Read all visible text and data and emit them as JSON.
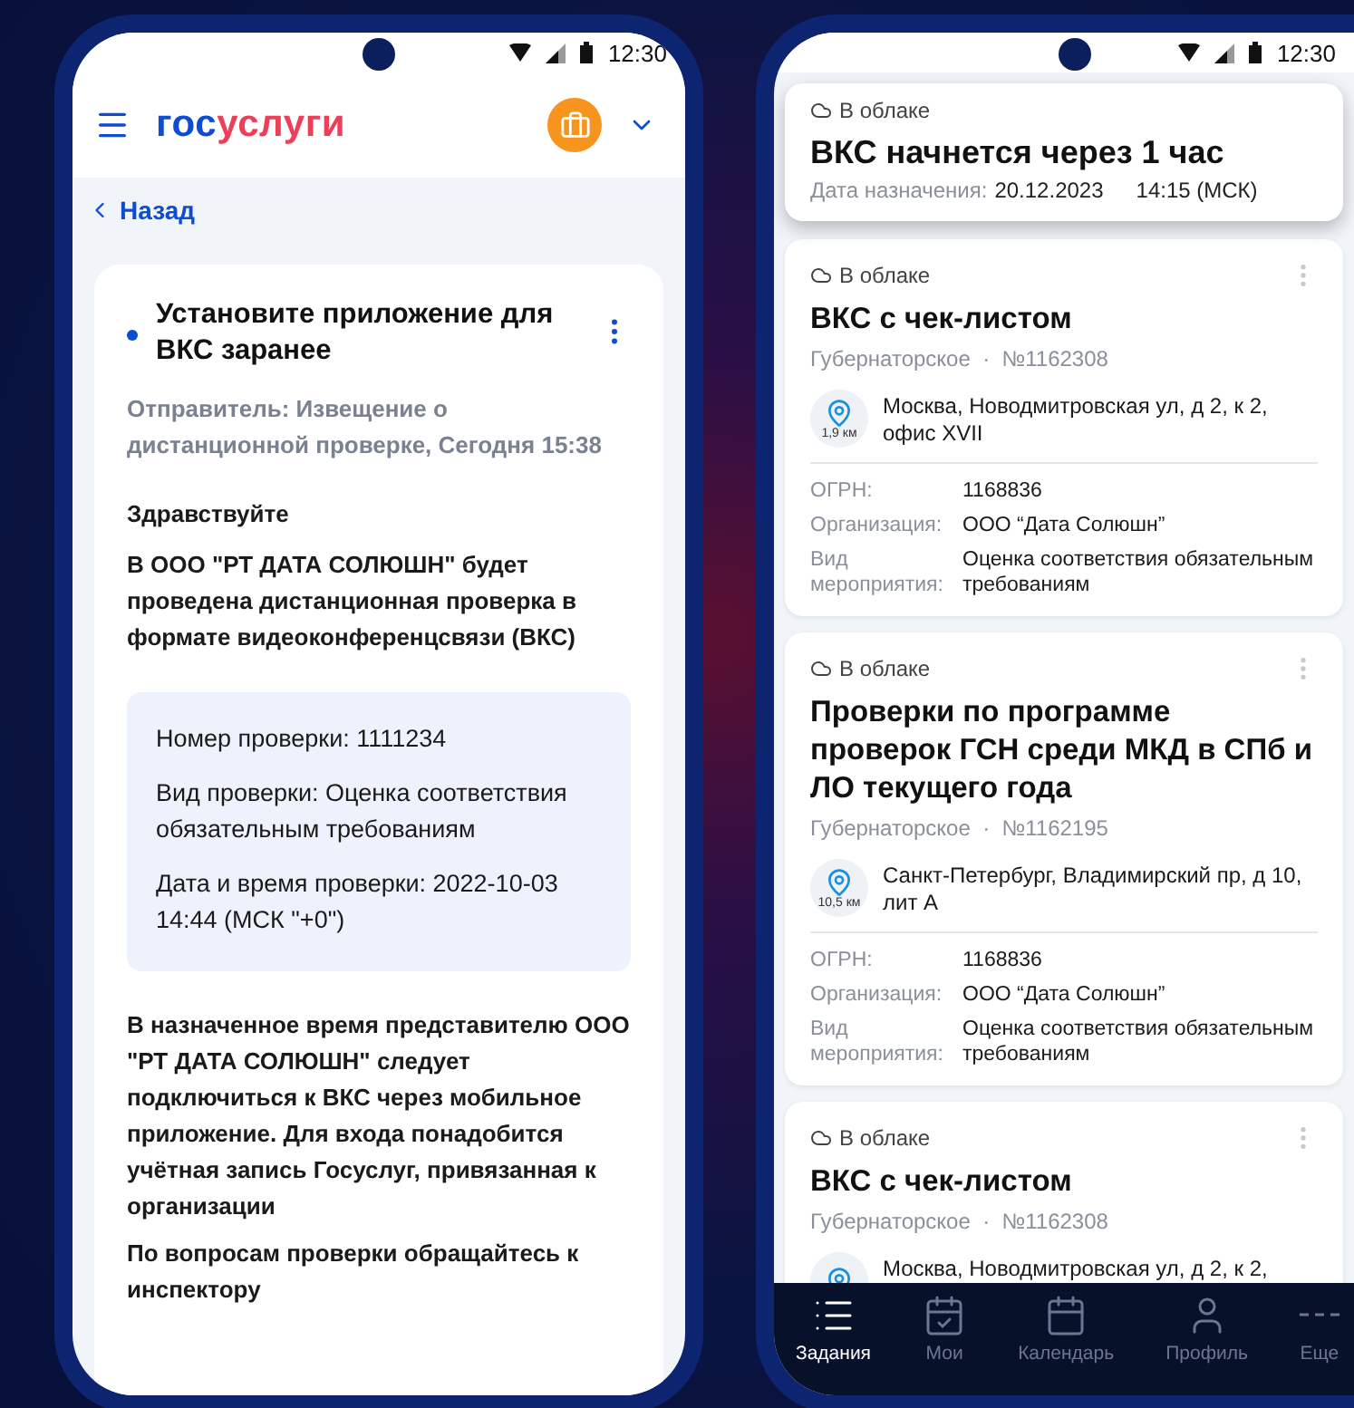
{
  "left_phone": {
    "status_bar": {
      "time": "12:30"
    },
    "header": {
      "logo": [
        {
          "text": "гос",
          "color": "#0d4cd3"
        },
        {
          "text": "услуги",
          "color": "#ee3f58"
        }
      ]
    },
    "back_link": "Назад",
    "message": {
      "unread": true,
      "title": "Установите приложение для ВКС заранее",
      "sender": "Отправитель: Извещение о дистанционной проверке, Сегодня 15:38",
      "greeting": "Здравствуйте",
      "intro": "В ООО \"РТ ДАТА СОЛЮШН\" будет проведена дистанционная проверка в формате видеоконференцсвязи (ВКС)",
      "details": [
        "Номер проверки: 1111234",
        "Вид проверки: Оценка соответствия обязательным требованиям",
        "Дата и время проверки: 2022-10-03 14:44  (МСК \"+0\")"
      ],
      "paragraphs": [
        "В назначенное время представителю ООО \"РТ ДАТА СОЛЮШН\" следует подключиться к ВКС через мобильное приложение. Для входа понадобится учётная запись Госуслуг, привязанная к организации",
        "По вопросам проверки обращайтесь к инспектору"
      ]
    }
  },
  "right_phone": {
    "status_bar": {
      "time": "12:30"
    },
    "notification": {
      "tag": "В облаке",
      "title": "ВКС начнется через 1 час",
      "date_label": "Дата назначения:",
      "date": "20.12.2023",
      "time": "14:15 (МСК)"
    },
    "cards": [
      {
        "tag": "В облаке",
        "title": "ВКС с чек-листом",
        "org": "Губернаторское",
        "separator": "·",
        "number": "№1162308",
        "distance": "1,9 км",
        "address": "Москва, Новодмитровская ул, д 2, к 2, офис XVII",
        "fields": [
          {
            "label": "ОГРН:",
            "value": "1168836"
          },
          {
            "label": "Организация:",
            "value": "ООО “Дата Солюшн”"
          },
          {
            "label": "Вид мероприятия:",
            "value": "Оценка соответствия обязательным требованиям"
          }
        ]
      },
      {
        "tag": "В облаке",
        "title": "Проверки по программе проверок ГСН среди МКД в СПб и ЛО текущего года",
        "org": "Губернаторское",
        "separator": "·",
        "number": "№1162195",
        "distance": "10,5 км",
        "address": "Санкт-Петербург, Владимирский пр, д 10, лит А",
        "fields": [
          {
            "label": "ОГРН:",
            "value": "1168836"
          },
          {
            "label": "Организация:",
            "value": "ООО “Дата Солюшн”"
          },
          {
            "label": "Вид мероприятия:",
            "value": "Оценка соответствия обязательным требованиям"
          }
        ]
      },
      {
        "tag": "В облаке",
        "title": "ВКС с чек-листом",
        "org": "Губернаторское",
        "separator": "·",
        "number": "№1162308",
        "address": "Москва, Новодмитровская ул, д 2, к 2,"
      }
    ],
    "nav": [
      {
        "label": "Задания",
        "selected": true
      },
      {
        "label": "Мои",
        "selected": false
      },
      {
        "label": "Календарь",
        "selected": false
      },
      {
        "label": "Профиль",
        "selected": false
      },
      {
        "label": "Еще",
        "selected": false
      }
    ]
  }
}
